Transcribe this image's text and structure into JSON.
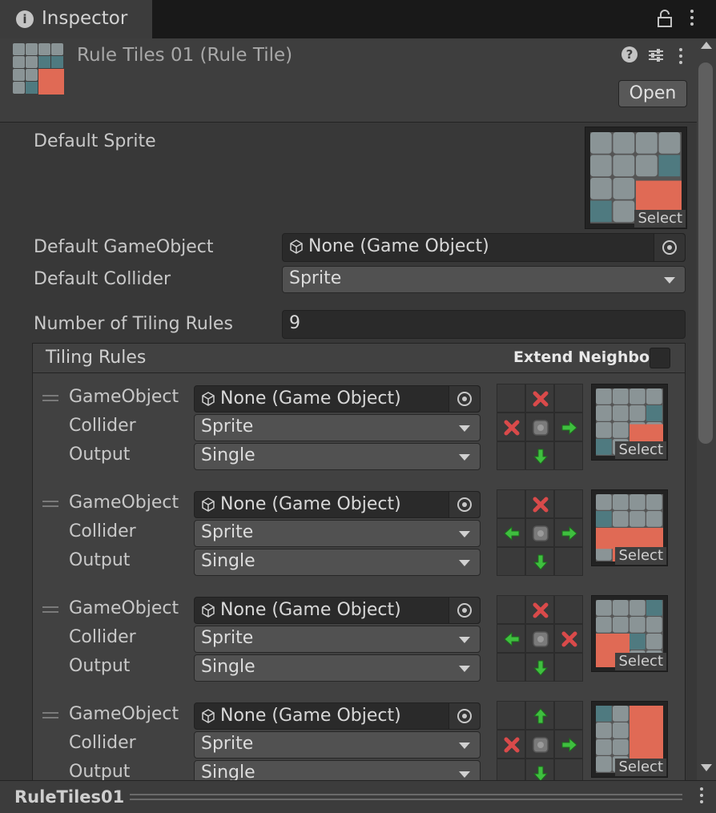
{
  "tab": {
    "title": "Inspector",
    "info_icon": "info-icon"
  },
  "header": {
    "title": "Rule Tiles 01 (Rule Tile)",
    "open_label": "Open"
  },
  "default_sprite": {
    "label": "Default Sprite",
    "select_label": "Select"
  },
  "default_gameobject": {
    "label": "Default GameObject",
    "value": "None (Game Object)"
  },
  "default_collider": {
    "label": "Default Collider",
    "value": "Sprite"
  },
  "num_rules": {
    "label": "Number of Tiling Rules",
    "value": "9"
  },
  "tiling_rules": {
    "title": "Tiling Rules",
    "extend_neighbor_label": "Extend Neighbor",
    "extend_neighbor_checked": false,
    "rules": [
      {
        "gameobject_label": "GameObject",
        "gameobject_value": "None (Game Object)",
        "collider_label": "Collider",
        "collider_value": "Sprite",
        "output_label": "Output",
        "output_value": "Single",
        "select_label": "Select",
        "neighbors": [
          "",
          "x",
          "",
          "x",
          "",
          "right",
          "",
          "down",
          ""
        ]
      },
      {
        "gameobject_label": "GameObject",
        "gameobject_value": "None (Game Object)",
        "collider_label": "Collider",
        "collider_value": "Sprite",
        "output_label": "Output",
        "output_value": "Single",
        "select_label": "Select",
        "neighbors": [
          "",
          "x",
          "",
          "left",
          "",
          "right",
          "",
          "down",
          ""
        ]
      },
      {
        "gameobject_label": "GameObject",
        "gameobject_value": "None (Game Object)",
        "collider_label": "Collider",
        "collider_value": "Sprite",
        "output_label": "Output",
        "output_value": "Single",
        "select_label": "Select",
        "neighbors": [
          "",
          "x",
          "",
          "left",
          "",
          "x",
          "",
          "down",
          ""
        ]
      },
      {
        "gameobject_label": "GameObject",
        "gameobject_value": "None (Game Object)",
        "collider_label": "Collider",
        "collider_value": "Sprite",
        "output_label": "Output",
        "output_value": "Single",
        "select_label": "Select",
        "neighbors": [
          "",
          "up",
          "",
          "x",
          "",
          "right",
          "",
          "down",
          ""
        ]
      }
    ]
  },
  "footer": {
    "name": "RuleTiles01"
  },
  "colors": {
    "background": "#383838",
    "tile_red": "#e06a55",
    "tile_gray": "#8a9496",
    "tile_teal": "#4f7a80",
    "arrow_green": "#3fbf3f",
    "x_red": "#d94a4a"
  }
}
